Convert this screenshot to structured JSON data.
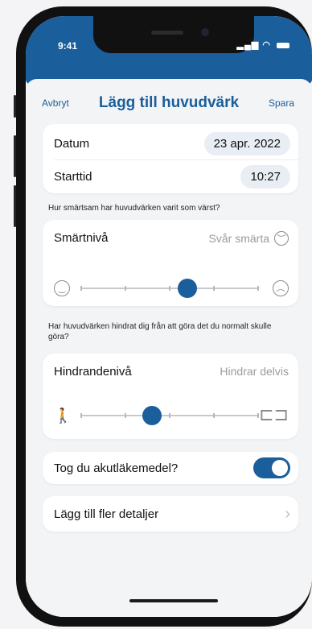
{
  "status_bar": {
    "time": "9:41",
    "icons": "▐▌▐ ◠"
  },
  "nav": {
    "cancel": "Avbryt",
    "title": "Lägg till huvudvärk",
    "save": "Spara"
  },
  "date_card": {
    "date_label": "Datum",
    "date_value": "23 apr. 2022",
    "time_label": "Starttid",
    "time_value": "10:27"
  },
  "pain": {
    "question": "Hur smärtsam har huvudvärken varit som värst?",
    "label": "Smärtnivå",
    "value_text": "Svår smärta",
    "level": 0.6,
    "steps": 5,
    "min_icon": "smiley-face-icon",
    "max_icon": "sad-face-icon"
  },
  "hindrance": {
    "question": "Har huvudvärken hindrat dig från att göra det du normalt skulle göra?",
    "label": "Hindrandenivå",
    "value_text": "Hindrar delvis",
    "level": 0.4,
    "steps": 5,
    "min_icon": "walking-person-icon",
    "max_icon": "bed-icon"
  },
  "medication": {
    "label": "Tog du akutläkemedel?",
    "on": true
  },
  "details": {
    "label": "Lägg till fler detaljer"
  },
  "colors": {
    "accent": "#1a5e9b",
    "background": "#f3f4f6",
    "pill": "#e8eef3"
  }
}
